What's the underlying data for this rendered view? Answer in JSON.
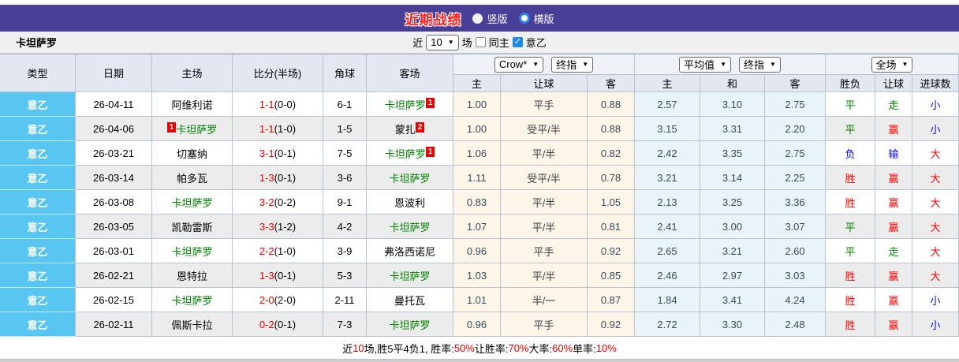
{
  "topbar": {
    "title": "近期战绩",
    "radio_vertical": "竖版",
    "radio_horizontal": "横版",
    "selected_layout": "横版"
  },
  "filter": {
    "team": "卡坦萨罗",
    "near_label": "近",
    "match_count": "10",
    "matches_label": "场",
    "same_home_label": "同主",
    "same_home_checked": false,
    "league_label": "意乙",
    "league_checked": true
  },
  "table": {
    "left_headers": [
      "类型",
      "日期",
      "主场",
      "比分(半场)",
      "角球",
      "客场"
    ],
    "dropdowns": {
      "provider": "Crow*",
      "provider_final": "终指",
      "average": "平均值",
      "average_final": "终指",
      "full_match": "全场"
    },
    "sub_headers": [
      "主",
      "让球",
      "客",
      "主",
      "和",
      "客",
      "胜负",
      "让球",
      "进球数"
    ],
    "rows": [
      {
        "league": "意乙",
        "date": "26-04-11",
        "home": {
          "name": "阿维利诺",
          "green": false
        },
        "score": "1-1",
        "half": "(0-0)",
        "corner": "6-1",
        "away": {
          "name": "卡坦萨罗",
          "green": true,
          "badge": "1",
          "badge_pos": "after"
        },
        "odds": [
          "1.00",
          "平手",
          "0.88"
        ],
        "avg": [
          "2.57",
          "3.10",
          "2.75"
        ],
        "results": [
          "平",
          "走",
          "小"
        ]
      },
      {
        "league": "意乙",
        "date": "26-04-06",
        "home": {
          "name": "卡坦萨罗",
          "green": true,
          "badge": "1",
          "badge_pos": "before"
        },
        "score": "1-1",
        "half": "(1-0)",
        "corner": "1-5",
        "away": {
          "name": "蒙扎",
          "green": false,
          "badge": "2",
          "badge_pos": "after"
        },
        "odds": [
          "1.00",
          "受平/半",
          "0.88"
        ],
        "avg": [
          "3.15",
          "3.31",
          "2.20"
        ],
        "results": [
          "平",
          "赢",
          "小"
        ]
      },
      {
        "league": "意乙",
        "date": "26-03-21",
        "home": {
          "name": "切塞纳",
          "green": false
        },
        "score": "3-1",
        "half": "(0-1)",
        "corner": "7-5",
        "away": {
          "name": "卡坦萨罗",
          "green": true,
          "badge": "1",
          "badge_pos": "after"
        },
        "odds": [
          "1.06",
          "平/半",
          "0.82"
        ],
        "avg": [
          "2.42",
          "3.35",
          "2.75"
        ],
        "results": [
          "负",
          "输",
          "大"
        ]
      },
      {
        "league": "意乙",
        "date": "26-03-14",
        "home": {
          "name": "帕多瓦",
          "green": false
        },
        "score": "1-3",
        "half": "(0-1)",
        "corner": "3-6",
        "away": {
          "name": "卡坦萨罗",
          "green": true
        },
        "odds": [
          "1.11",
          "受平/半",
          "0.78"
        ],
        "avg": [
          "3.21",
          "3.14",
          "2.25"
        ],
        "results": [
          "胜",
          "赢",
          "大"
        ]
      },
      {
        "league": "意乙",
        "date": "26-03-08",
        "home": {
          "name": "卡坦萨罗",
          "green": true
        },
        "score": "3-2",
        "half": "(0-2)",
        "corner": "9-1",
        "away": {
          "name": "恩波利",
          "green": false
        },
        "odds": [
          "0.83",
          "平/半",
          "1.05"
        ],
        "avg": [
          "2.13",
          "3.25",
          "3.36"
        ],
        "results": [
          "胜",
          "赢",
          "大"
        ]
      },
      {
        "league": "意乙",
        "date": "26-03-05",
        "home": {
          "name": "凯勒雷斯",
          "green": false
        },
        "score": "3-3",
        "half": "(1-2)",
        "corner": "4-2",
        "away": {
          "name": "卡坦萨罗",
          "green": true
        },
        "odds": [
          "1.07",
          "平/半",
          "0.81"
        ],
        "avg": [
          "2.41",
          "3.00",
          "3.07"
        ],
        "results": [
          "平",
          "赢",
          "大"
        ]
      },
      {
        "league": "意乙",
        "date": "26-03-01",
        "home": {
          "name": "卡坦萨罗",
          "green": true
        },
        "score": "2-2",
        "half": "(1-0)",
        "corner": "3-9",
        "away": {
          "name": "弗洛西诺尼",
          "green": false
        },
        "odds": [
          "0.96",
          "平手",
          "0.92"
        ],
        "avg": [
          "2.65",
          "3.21",
          "2.60"
        ],
        "results": [
          "平",
          "走",
          "大"
        ]
      },
      {
        "league": "意乙",
        "date": "26-02-21",
        "home": {
          "name": "恩特拉",
          "green": false
        },
        "score": "1-3",
        "half": "(0-1)",
        "corner": "5-3",
        "away": {
          "name": "卡坦萨罗",
          "green": true
        },
        "odds": [
          "1.03",
          "平/半",
          "0.85"
        ],
        "avg": [
          "2.46",
          "2.97",
          "3.03"
        ],
        "results": [
          "胜",
          "赢",
          "大"
        ]
      },
      {
        "league": "意乙",
        "date": "26-02-15",
        "home": {
          "name": "卡坦萨罗",
          "green": true
        },
        "score": "2-0",
        "half": "(2-0)",
        "corner": "2-11",
        "away": {
          "name": "曼托瓦",
          "green": false
        },
        "odds": [
          "1.01",
          "半/一",
          "0.87"
        ],
        "avg": [
          "1.84",
          "3.41",
          "4.24"
        ],
        "results": [
          "胜",
          "赢",
          "小"
        ]
      },
      {
        "league": "意乙",
        "date": "26-02-11",
        "home": {
          "name": "佩斯卡拉",
          "green": false
        },
        "score": "0-2",
        "half": "(0-1)",
        "corner": "7-3",
        "away": {
          "name": "卡坦萨罗",
          "green": true
        },
        "odds": [
          "0.96",
          "平手",
          "0.92"
        ],
        "avg": [
          "2.72",
          "3.30",
          "2.48"
        ],
        "results": [
          "胜",
          "赢",
          "小"
        ]
      }
    ]
  },
  "result_colors": {
    "胜": "res-red",
    "平": "res-green",
    "负": "res-blue",
    "赢": "res-red",
    "走": "res-green",
    "输": "res-blue",
    "大": "res-red",
    "小": "res-blue"
  },
  "summary": {
    "segments": [
      {
        "text": "近",
        "red": false
      },
      {
        "text": "10",
        "red": true
      },
      {
        "text": "场,胜5平4负1, 胜率:",
        "red": false
      },
      {
        "text": "50%",
        "red": true
      },
      {
        "text": " 让胜率:",
        "red": false
      },
      {
        "text": "70%",
        "red": true
      },
      {
        "text": " 大率:",
        "red": false
      },
      {
        "text": "60%",
        "red": true
      },
      {
        "text": " 单率:",
        "red": false
      },
      {
        "text": "10%",
        "red": true
      }
    ]
  },
  "colors": {
    "titlebar_bg": "#4a3f96",
    "title_text": "#ff2020",
    "league_badge_bg": "#58c6f0",
    "header_bg": "#e2e7f1",
    "odds_bg": "#fdf6e8",
    "avg_bg": "#e9f3fa",
    "alt_row_bg": "#ececec",
    "win_red": "#ff0000",
    "draw_green": "#008000",
    "loss_blue": "#0008ff"
  }
}
